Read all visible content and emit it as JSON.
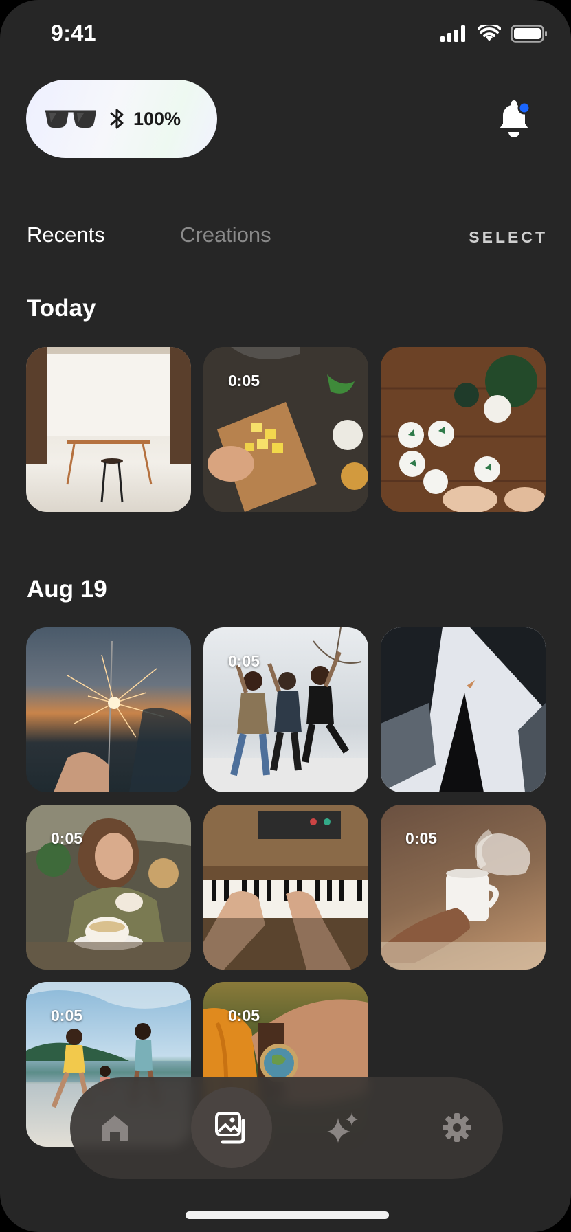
{
  "status_bar": {
    "time": "9:41"
  },
  "device": {
    "battery": "100%"
  },
  "tabs": {
    "recents": "Recents",
    "creations": "Creations",
    "select": "SELECT"
  },
  "sections": [
    {
      "title": "Today",
      "items": [
        {
          "kind": "photo",
          "subject": "studio table and stool"
        },
        {
          "kind": "video",
          "duration": "0:05",
          "subject": "chopping potatoes"
        },
        {
          "kind": "photo",
          "subject": "painting botanical coasters"
        }
      ]
    },
    {
      "title": "Aug 19",
      "items": [
        {
          "kind": "photo",
          "subject": "sparkler at dusk"
        },
        {
          "kind": "video",
          "duration": "0:05",
          "subject": "friends jumping"
        },
        {
          "kind": "photo",
          "subject": "skyscrapers looking up"
        },
        {
          "kind": "video",
          "duration": "0:05",
          "subject": "woman with coffee"
        },
        {
          "kind": "photo",
          "subject": "playing keyboard"
        },
        {
          "kind": "video",
          "duration": "0:05",
          "subject": "steaming coffee mug"
        },
        {
          "kind": "video",
          "duration": "0:05",
          "subject": "kids on beach"
        },
        {
          "kind": "video",
          "duration": "0:05",
          "subject": "wristwatch"
        }
      ]
    }
  ],
  "nav": [
    {
      "icon": "home-icon",
      "active": false
    },
    {
      "icon": "gallery-icon",
      "active": true
    },
    {
      "icon": "sparkle-icon",
      "active": false
    },
    {
      "icon": "gear-icon",
      "active": false
    }
  ],
  "colors": {
    "background": "#262626",
    "notification_dot": "#1a66ff"
  }
}
